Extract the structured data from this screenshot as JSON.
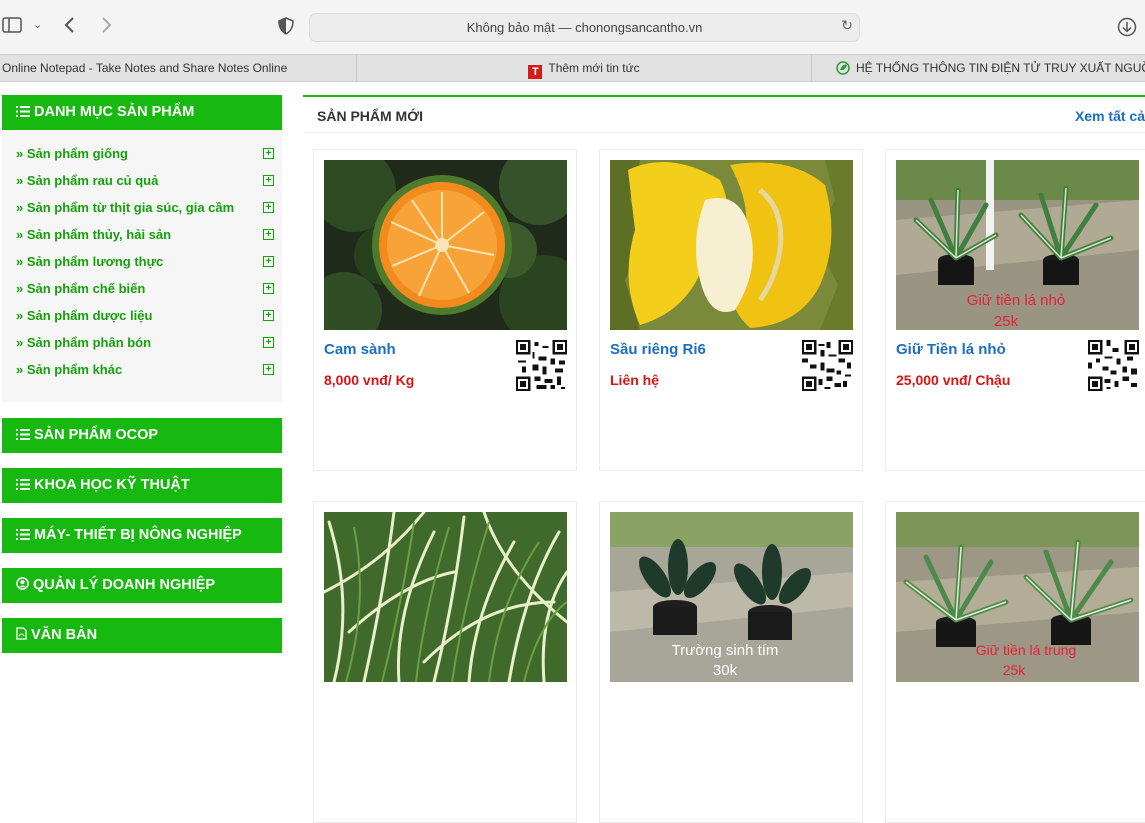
{
  "browser": {
    "address": "Không bảo mật — chonongsancantho.vn",
    "tabs": [
      {
        "label": "Online Notepad - Take Notes and Share Notes Online"
      },
      {
        "label": "Thêm mới tin tức"
      },
      {
        "label": "HỆ THỐNG THÔNG TIN ĐIỆN TỬ TRUY XUẤT NGUỒN GỐ"
      }
    ]
  },
  "sidebar": {
    "category_title": "DANH MỤC SẢN PHẨM",
    "categories": [
      {
        "label": "» Sản phẩm giống"
      },
      {
        "label": "» Sản phẩm rau củ quả"
      },
      {
        "label": "» Sản phẩm từ thịt gia súc, gia cầm"
      },
      {
        "label": "» Sản phẩm thủy, hải sản"
      },
      {
        "label": "» Sản phẩm lương thực"
      },
      {
        "label": "» Sản phẩm chế biến"
      },
      {
        "label": "» Sản phẩm dược liệu"
      },
      {
        "label": "» Sản phẩm phân bón"
      },
      {
        "label": "» Sản phẩm khác"
      }
    ],
    "menus": [
      {
        "label": "SẢN PHẨM OCOP",
        "icon": "list-icon"
      },
      {
        "label": "KHOA HỌC KỸ THUẬT",
        "icon": "list-icon"
      },
      {
        "label": "MÁY- THIẾT BỊ NÔNG NGHIỆP",
        "icon": "list-icon"
      },
      {
        "label": "QUẢN LÝ DOANH NGHIỆP",
        "icon": "user-circle-icon"
      },
      {
        "label": "VĂN BẢN",
        "icon": "pdf-file-icon"
      }
    ],
    "accent_color": "#17b80f"
  },
  "main": {
    "title": "SẢN PHẨM MỚI",
    "see_all": "Xem tất cả",
    "products": [
      {
        "name": "Cam sành",
        "price": "8,000 vnđ/ Kg"
      },
      {
        "name": "Sầu riêng Ri6",
        "price": "Liên hệ"
      },
      {
        "name": "Giữ Tiền lá nhỏ",
        "price": "25,000 vnđ/ Chậu",
        "photo_caption": [
          "Giữ tiền lá nhỏ",
          "25k"
        ]
      },
      {
        "photo_caption": []
      },
      {
        "photo_caption": [
          "Trường sinh tím",
          "30k"
        ]
      },
      {
        "photo_caption": [
          "Giữ tiền lá trung",
          "25k"
        ]
      }
    ]
  }
}
